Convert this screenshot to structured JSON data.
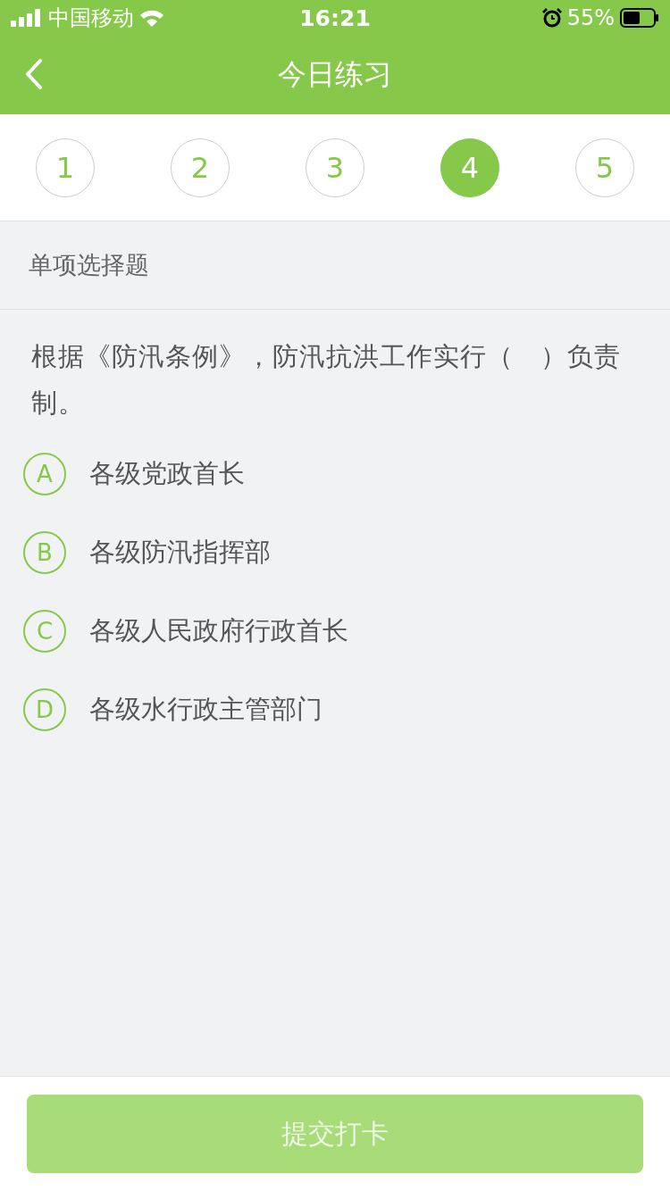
{
  "status_bar": {
    "carrier": "中国移动",
    "time": "16:21",
    "battery": "55%"
  },
  "nav": {
    "title": "今日练习"
  },
  "steps": [
    {
      "label": "1",
      "selected": false
    },
    {
      "label": "2",
      "selected": false
    },
    {
      "label": "3",
      "selected": false
    },
    {
      "label": "4",
      "selected": true
    },
    {
      "label": "5",
      "selected": false
    }
  ],
  "section": "单项选择题",
  "question": "根据《防汛条例》，防汛抗洪工作实行（　）负责制。",
  "options": [
    {
      "letter": "A",
      "text": "各级党政首长",
      "selected": false
    },
    {
      "letter": "B",
      "text": "各级防汛指挥部",
      "selected": false
    },
    {
      "letter": "C",
      "text": "各级人民政府行政首长",
      "selected": false
    },
    {
      "letter": "D",
      "text": "各级水行政主管部门",
      "selected": false
    }
  ],
  "submit": {
    "label": "提交打卡",
    "disabled": true
  }
}
